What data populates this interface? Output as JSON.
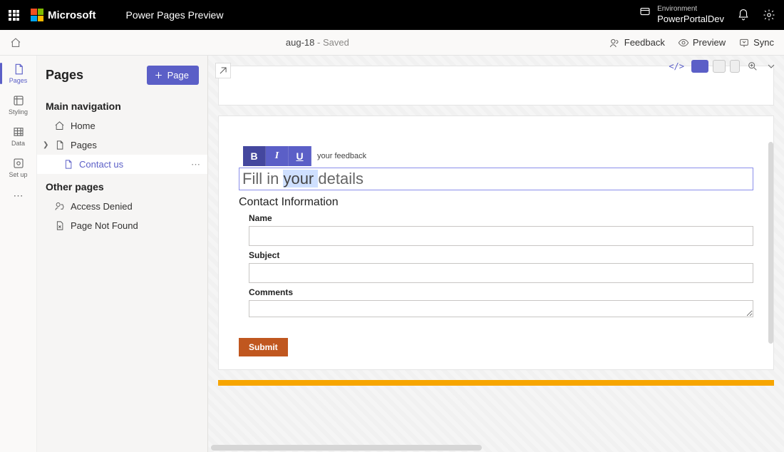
{
  "topbar": {
    "brand": "Microsoft",
    "app_title": "Power Pages Preview",
    "env_label": "Environment",
    "env_value": "PowerPortalDev"
  },
  "cmdbar": {
    "doc_name": "aug-18",
    "doc_status": "Saved",
    "actions": {
      "feedback": "Feedback",
      "preview": "Preview",
      "sync": "Sync"
    }
  },
  "rail": {
    "items": [
      {
        "id": "pages",
        "label": "Pages",
        "active": true
      },
      {
        "id": "styling",
        "label": "Styling",
        "active": false
      },
      {
        "id": "data",
        "label": "Data",
        "active": false
      },
      {
        "id": "setup",
        "label": "Set up",
        "active": false
      }
    ]
  },
  "sidepanel": {
    "title": "Pages",
    "add_page_label": "Page",
    "sections": {
      "main_nav": "Main navigation",
      "other": "Other pages"
    },
    "main_nav_items": [
      {
        "id": "home",
        "label": "Home",
        "icon": "home"
      },
      {
        "id": "pages",
        "label": "Pages",
        "icon": "page",
        "expandable": true
      },
      {
        "id": "contact-us",
        "label": "Contact us",
        "icon": "page",
        "active": true,
        "indent": true
      }
    ],
    "other_items": [
      {
        "id": "access-denied",
        "label": "Access Denied",
        "icon": "lock"
      },
      {
        "id": "page-not-found",
        "label": "Page Not Found",
        "icon": "page-x"
      }
    ]
  },
  "editor": {
    "rte_tail": "your feedback",
    "heading_parts": {
      "pre": "Fill in ",
      "sel": "your ",
      "post": "details"
    },
    "section_title": "Contact Information",
    "fields": {
      "name": "Name",
      "subject": "Subject",
      "comments": "Comments"
    },
    "submit_label": "Submit"
  }
}
